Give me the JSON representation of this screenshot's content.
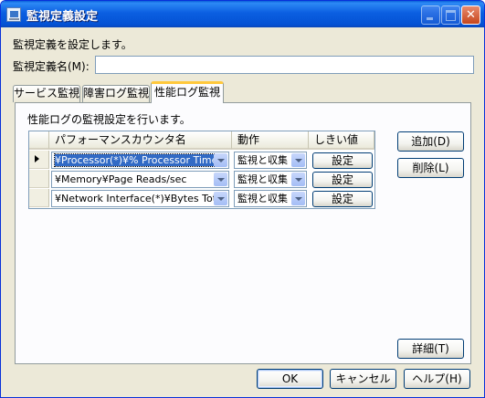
{
  "window": {
    "title": "監視定義設定"
  },
  "description": "監視定義を設定します。",
  "name_field": {
    "label": "監視定義名(M):",
    "value": ""
  },
  "tabs": [
    {
      "label": "サービス監視"
    },
    {
      "label": "障害ログ監視"
    },
    {
      "label": "性能ログ監視",
      "active": true
    }
  ],
  "panel": {
    "description": "性能ログの監視設定を行います。",
    "columns": [
      "パフォーマンスカウンタ名",
      "動作",
      "しきい値"
    ],
    "rows": [
      {
        "counter": "¥Processor(*)¥% Processor Time",
        "action": "監視と収集",
        "threshold_button": "設定",
        "selected": true
      },
      {
        "counter": "¥Memory¥Page Reads/sec",
        "action": "監視と収集",
        "threshold_button": "設定"
      },
      {
        "counter": "¥Network Interface(*)¥Bytes Tot…",
        "action": "監視と収集",
        "threshold_button": "設定"
      }
    ],
    "add_button": "追加(D)",
    "delete_button": "削除(L)",
    "detail_button": "詳細(T)"
  },
  "footer": {
    "ok": "OK",
    "cancel": "キャンセル",
    "help": "ヘルプ(H)"
  },
  "colors": {
    "titlebar": "#0b5fe1",
    "selection": "#316ac5",
    "dialog_bg": "#ece9d8",
    "active_tab_accent": "#ffc83c"
  }
}
